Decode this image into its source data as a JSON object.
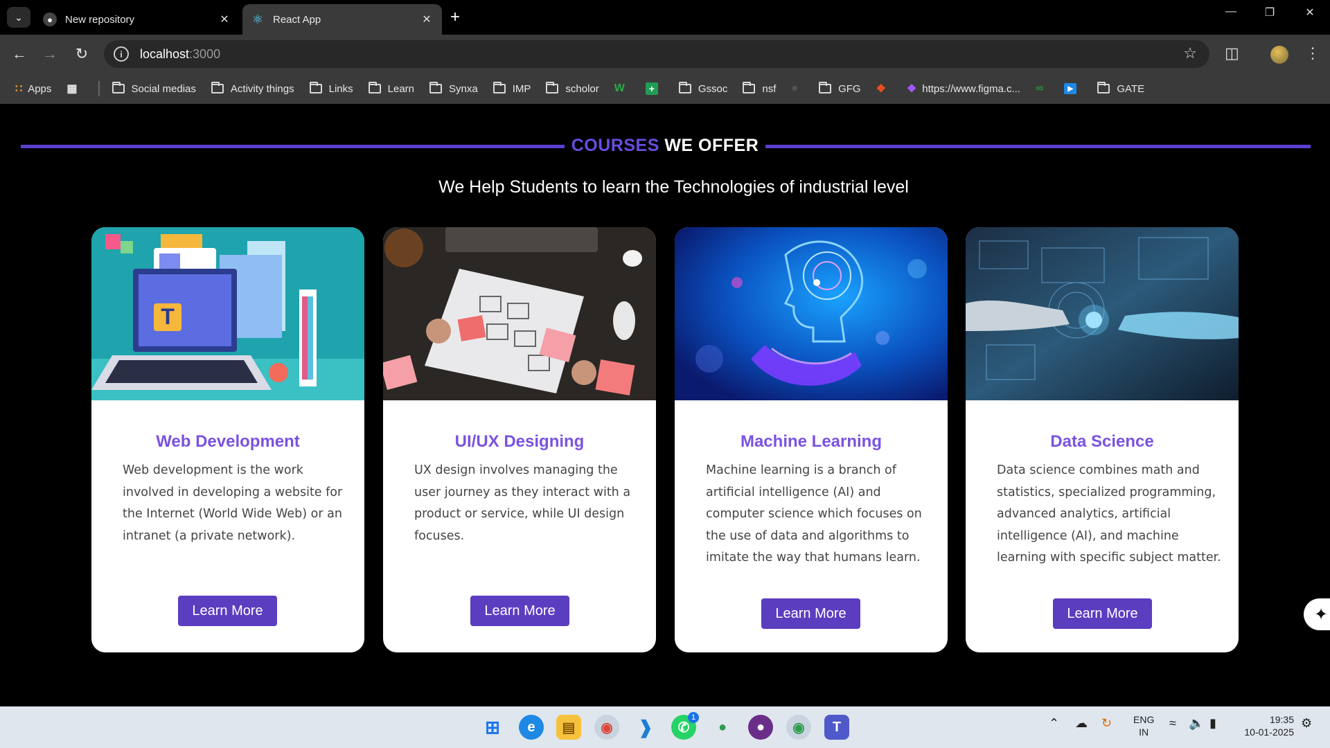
{
  "browser": {
    "tabs": [
      {
        "title": "New repository",
        "icon": "github-icon"
      },
      {
        "title": "React App",
        "icon": "react-icon"
      }
    ],
    "url_host": "localhost",
    "url_port": ":3000",
    "bookmarks": [
      {
        "label": "Apps",
        "icon": "apps-grid-icon"
      },
      {
        "label": "Social medias",
        "icon": "folder-icon"
      },
      {
        "label": "Activity things",
        "icon": "folder-icon"
      },
      {
        "label": "Links",
        "icon": "folder-icon"
      },
      {
        "label": "Learn",
        "icon": "folder-icon"
      },
      {
        "label": "Synxa",
        "icon": "folder-icon"
      },
      {
        "label": "IMP",
        "icon": "folder-icon"
      },
      {
        "label": "scholor",
        "icon": "folder-icon"
      },
      {
        "label": "Gssoc",
        "icon": "folder-icon"
      },
      {
        "label": "nsf",
        "icon": "folder-icon"
      },
      {
        "label": "GFG",
        "icon": "folder-icon"
      },
      {
        "label": "https://www.figma.c...",
        "icon": "figma-icon"
      },
      {
        "label": "GATE",
        "icon": "folder-icon"
      }
    ]
  },
  "page": {
    "heading_part1": "COURSES",
    "heading_part2": "WE OFFER",
    "subtitle": "We Help Students to learn the Technologies of industrial level",
    "cards": [
      {
        "title": "Web Development",
        "description": "Web development is the work involved in developing a website for the Internet (World Wide Web) or an intranet (a private network).",
        "button": "Learn More"
      },
      {
        "title": "UI/UX Designing",
        "description": "UX design involves managing the user journey as they interact with a product or service, while UI design focuses.",
        "button": "Learn More"
      },
      {
        "title": "Machine Learning",
        "description": "Machine learning is a branch of artificial intelligence (AI) and computer science which focuses on the use of data and algorithms to imitate the way that humans learn.",
        "button": "Learn More"
      },
      {
        "title": "Data Science",
        "description": "Data science combines math and statistics, specialized programming, advanced analytics, artificial intelligence (AI), and machine learning with specific subject matter.",
        "button": "Learn More"
      }
    ],
    "accent_color": "#5b3dc0",
    "title_color": "#7b52e0"
  },
  "taskbar": {
    "badge_whatsapp": "1",
    "lang_line1": "ENG",
    "lang_line2": "IN",
    "time": "19:35",
    "date": "10-01-2025"
  }
}
